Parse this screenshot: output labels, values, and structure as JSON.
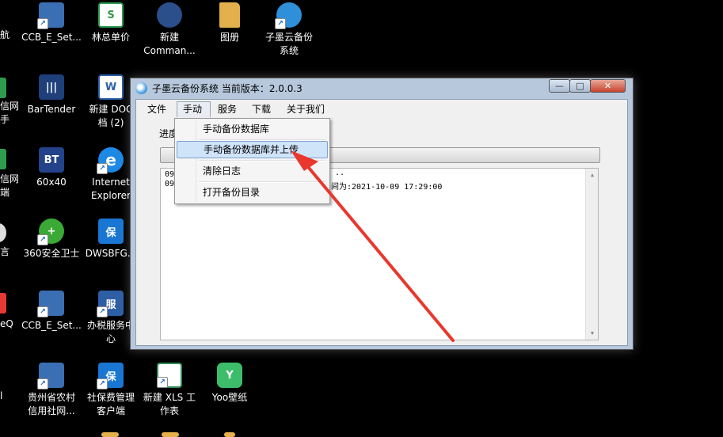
{
  "desktop": {
    "icons": [
      {
        "name": "ccb-e-set-1",
        "label": "CCB_E_Set...",
        "glyph": "",
        "color": "#3b6fb3",
        "shortcut": true
      },
      {
        "name": "lin-zong-danjia",
        "label": "林总单价",
        "glyph": "S",
        "color": "#2e9b4f",
        "shortcut": false
      },
      {
        "name": "new-command",
        "label": "新建\nComman...",
        "glyph": "",
        "color": "#2b4f8a",
        "shortcut": false
      },
      {
        "name": "tuzhi-folder",
        "label": "图册",
        "glyph": "",
        "color": "#e3b04b",
        "shortcut": false
      },
      {
        "name": "zimo-backup-system",
        "label": "子墨云备份\n系统",
        "glyph": "",
        "color": "#2f8fd8",
        "shortcut": true
      },
      {
        "name": "bartender",
        "label": "BarTender",
        "glyph": "|||",
        "color": "#1e3f7a",
        "shortcut": false
      },
      {
        "name": "new-doc",
        "label": "新建 DOC\n档 (2)",
        "glyph": "W",
        "color": "#2b5fa8",
        "shortcut": false
      },
      {
        "name": "60x40",
        "label": "60x40",
        "glyph": "BT",
        "color": "#23428a",
        "shortcut": false
      },
      {
        "name": "internet-explorer",
        "label": "Internet\nExplorer",
        "glyph": "e",
        "color": "#1e88e5",
        "shortcut": true
      },
      {
        "name": "360-safe",
        "label": "360安全卫士",
        "glyph": "+",
        "color": "#3aa935",
        "shortcut": true
      },
      {
        "name": "dwsbfg",
        "label": "DWSBFG...",
        "glyph": "保",
        "color": "#1976d2",
        "shortcut": false
      },
      {
        "name": "ccb-e-set-2",
        "label": "CCB_E_Set...",
        "glyph": "",
        "color": "#3b6fb3",
        "shortcut": true
      },
      {
        "name": "tax-service-center",
        "label": "办税服务中\n心",
        "glyph": "服",
        "color": "#2e5fa5",
        "shortcut": true
      },
      {
        "name": "guizhou-rural-credit",
        "label": "贵州省农村\n信用社网...",
        "glyph": "",
        "color": "#3b6fb3",
        "shortcut": true
      },
      {
        "name": "social-insurance-client",
        "label": "社保费管理\n客户端",
        "glyph": "保",
        "color": "#1976d2",
        "shortcut": true
      },
      {
        "name": "new-xls",
        "label": "新建 XLS 工\n作表",
        "glyph": "",
        "color": "#2e8b57",
        "shortcut": true
      },
      {
        "name": "yoo-wallpaper",
        "label": "Yoo壁纸",
        "glyph": "Y",
        "color": "#3dbd6a",
        "shortcut": false
      }
    ],
    "partial_labels": [
      "航",
      "信网\n手",
      "信网\n端",
      "言",
      "eQ",
      "l"
    ]
  },
  "window": {
    "title": "子墨云备份系统  当前版本：2.0.0.3",
    "controls": {
      "minimize": "—",
      "maximize": "□",
      "close": "✕"
    },
    "menu": [
      "文件",
      "手动",
      "服务",
      "下载",
      "关于我们"
    ],
    "progress_label": "进度",
    "progress_value": 0,
    "log_lines": [
      "09",
      "09"
    ],
    "log_fragments": [
      "..",
      "间为:2021-10-09 17:29:00"
    ]
  },
  "dropdown": {
    "items": [
      "手动备份数据库",
      "手动备份数据库并上传",
      "清除日志",
      "打开备份目录"
    ],
    "highlighted_index": 1
  },
  "colors": {
    "annotation_arrow": "#e8382d",
    "highlight": "#cfe3f9"
  }
}
